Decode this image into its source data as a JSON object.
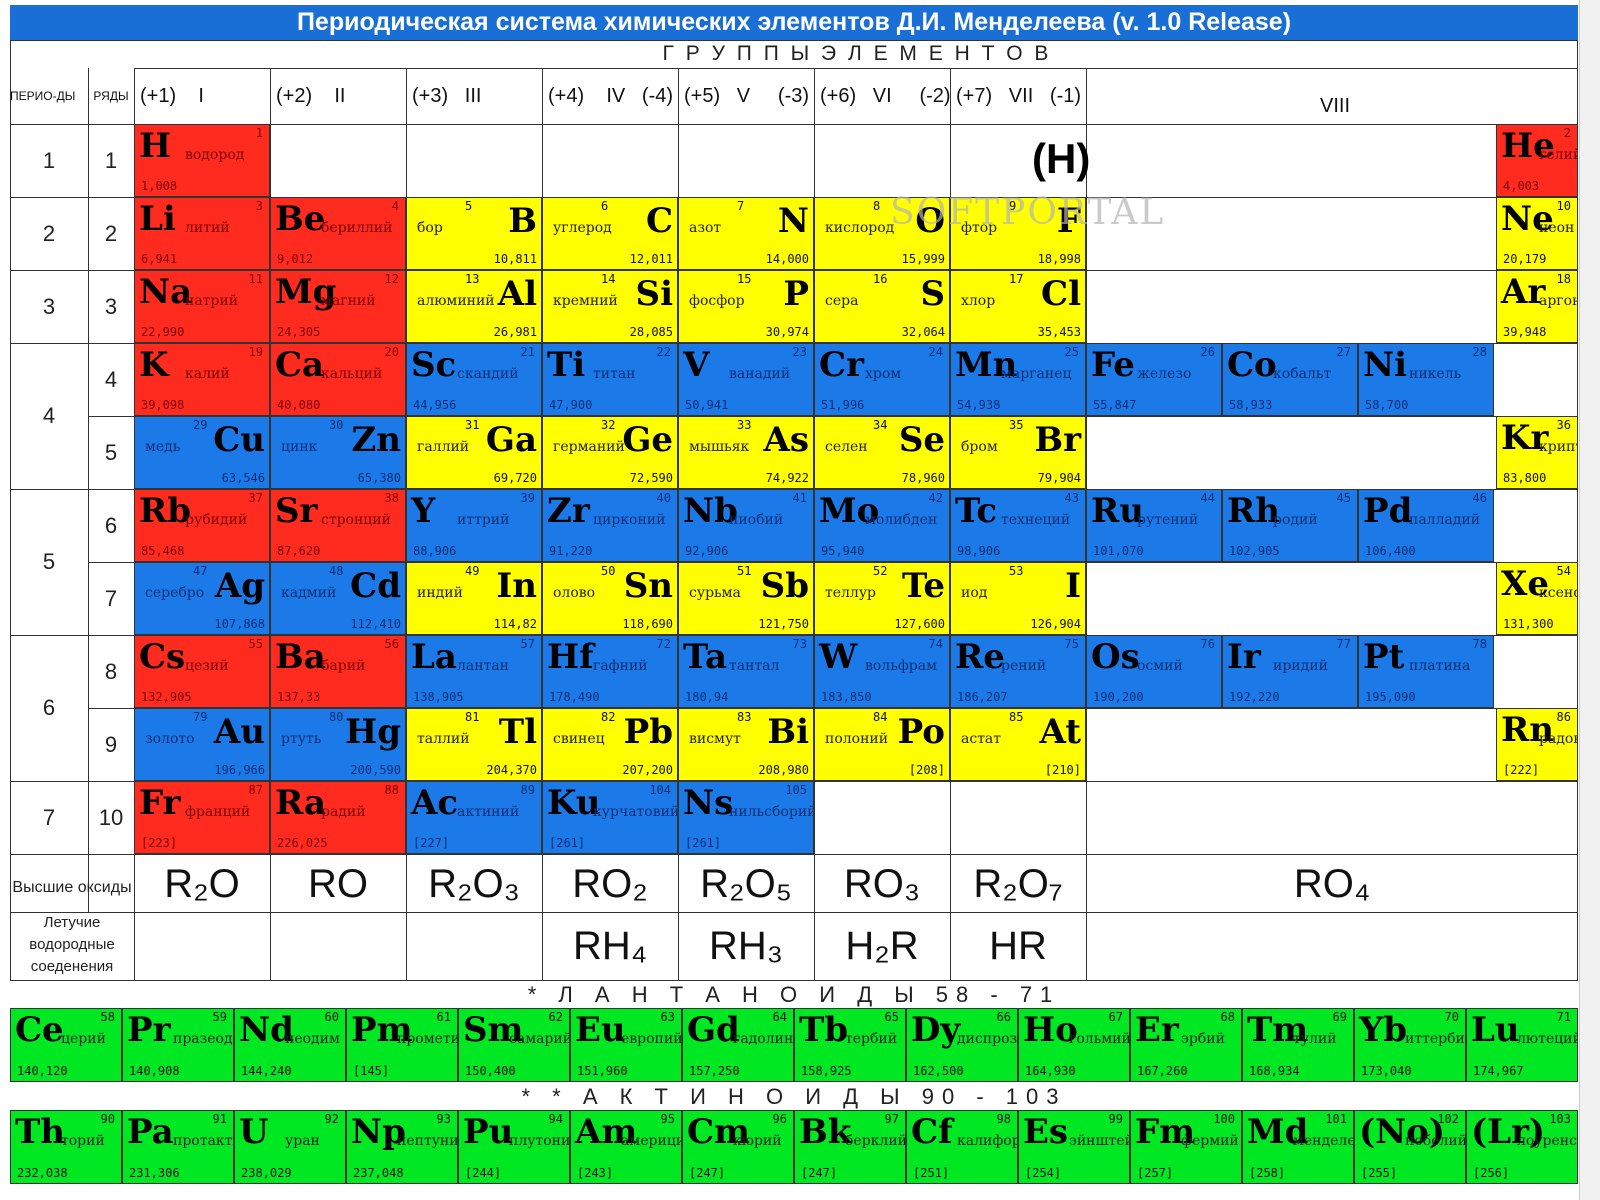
{
  "title": "Периодическая система химических элементов Д.И. Менделеева (v. 1.0 Release)",
  "groups_title": "Г Р У П П Ы      Э Л Е М Е Н Т О В",
  "headers": {
    "periods": "ПЕРИО-ДЫ",
    "rows": "РЯДЫ"
  },
  "group_labels": [
    "(+1)    I",
    "(+2)    II",
    "(+3)   III",
    "(+4)    IV   (-4)",
    "(+5)   V     (-3)",
    "(+6)   VI     (-2)",
    "(+7)   VII   (-1)",
    "VIII"
  ],
  "periods": [
    "1",
    "2",
    "3",
    "4",
    "5",
    "6",
    "7"
  ],
  "rows": [
    "1",
    "2",
    "3",
    "4",
    "5",
    "6",
    "7",
    "8",
    "9",
    "10"
  ],
  "h_mark": "(H)",
  "watermark": "SOFTPORTAL",
  "oxides_label": "Высшие оксиды",
  "oxides": [
    "R₂O",
    "RO",
    "R₂O₃",
    "RO₂",
    "R₂O₅",
    "RO₃",
    "R₂O₇",
    "RO₄"
  ],
  "hydrides_label": "Летучие водородные соеденения",
  "hydrides": [
    "RH₄",
    "RH₃",
    "H₂R",
    "HR"
  ],
  "lanthanides_label": "* Л А Н Т А Н О И Д Ы  58 - 71",
  "actinides_label": "* * А К Т И Н О И Д Ы  90 - 103",
  "elements": [
    {
      "s": "H",
      "n": "водород",
      "z": "1",
      "m": "1,008",
      "c": "red"
    },
    {
      "s": "He",
      "n": "гелий",
      "z": "2",
      "m": "4,003",
      "c": "red"
    },
    {
      "s": "Li",
      "n": "литий",
      "z": "3",
      "m": "6,941",
      "c": "red"
    },
    {
      "s": "Be",
      "n": "бериллий",
      "z": "4",
      "m": "9,012",
      "c": "red"
    },
    {
      "s": "B",
      "n": "бор",
      "z": "5",
      "m": "10,811",
      "c": "yel"
    },
    {
      "s": "C",
      "n": "углерод",
      "z": "6",
      "m": "12,011",
      "c": "yel"
    },
    {
      "s": "N",
      "n": "азот",
      "z": "7",
      "m": "14,000",
      "c": "yel"
    },
    {
      "s": "O",
      "n": "кислород",
      "z": "8",
      "m": "15,999",
      "c": "yel"
    },
    {
      "s": "F",
      "n": "фтор",
      "z": "9",
      "m": "18,998",
      "c": "yel"
    },
    {
      "s": "Ne",
      "n": "неон",
      "z": "10",
      "m": "20,179",
      "c": "yel"
    },
    {
      "s": "Na",
      "n": "натрий",
      "z": "11",
      "m": "22,990",
      "c": "red"
    },
    {
      "s": "Mg",
      "n": "магний",
      "z": "12",
      "m": "24,305",
      "c": "red"
    },
    {
      "s": "Al",
      "n": "алюминий",
      "z": "13",
      "m": "26,981",
      "c": "yel"
    },
    {
      "s": "Si",
      "n": "кремний",
      "z": "14",
      "m": "28,085",
      "c": "yel"
    },
    {
      "s": "P",
      "n": "фосфор",
      "z": "15",
      "m": "30,974",
      "c": "yel"
    },
    {
      "s": "S",
      "n": "сера",
      "z": "16",
      "m": "32,064",
      "c": "yel"
    },
    {
      "s": "Cl",
      "n": "хлор",
      "z": "17",
      "m": "35,453",
      "c": "yel"
    },
    {
      "s": "Ar",
      "n": "аргон",
      "z": "18",
      "m": "39,948",
      "c": "yel"
    },
    {
      "s": "K",
      "n": "калий",
      "z": "19",
      "m": "39,098",
      "c": "red"
    },
    {
      "s": "Ca",
      "n": "кальций",
      "z": "20",
      "m": "40,080",
      "c": "red"
    },
    {
      "s": "Sc",
      "n": "скандий",
      "z": "21",
      "m": "44,956",
      "c": "blu"
    },
    {
      "s": "Ti",
      "n": "титан",
      "z": "22",
      "m": "47,900",
      "c": "blu"
    },
    {
      "s": "V",
      "n": "ванадий",
      "z": "23",
      "m": "50,941",
      "c": "blu"
    },
    {
      "s": "Cr",
      "n": "хром",
      "z": "24",
      "m": "51,996",
      "c": "blu"
    },
    {
      "s": "Mn",
      "n": "марганец",
      "z": "25",
      "m": "54,938",
      "c": "blu"
    },
    {
      "s": "Fe",
      "n": "железо",
      "z": "26",
      "m": "55,847",
      "c": "blu"
    },
    {
      "s": "Co",
      "n": "кобальт",
      "z": "27",
      "m": "58,933",
      "c": "blu"
    },
    {
      "s": "Ni",
      "n": "никель",
      "z": "28",
      "m": "58,700",
      "c": "blu"
    },
    {
      "s": "Cu",
      "n": "медь",
      "z": "29",
      "m": "63,546",
      "c": "blu"
    },
    {
      "s": "Zn",
      "n": "цинк",
      "z": "30",
      "m": "65,380",
      "c": "blu"
    },
    {
      "s": "Ga",
      "n": "галлий",
      "z": "31",
      "m": "69,720",
      "c": "yel"
    },
    {
      "s": "Ge",
      "n": "германий",
      "z": "32",
      "m": "72,590",
      "c": "yel"
    },
    {
      "s": "As",
      "n": "мышьяк",
      "z": "33",
      "m": "74,922",
      "c": "yel"
    },
    {
      "s": "Se",
      "n": "селен",
      "z": "34",
      "m": "78,960",
      "c": "yel"
    },
    {
      "s": "Br",
      "n": "бром",
      "z": "35",
      "m": "79,904",
      "c": "yel"
    },
    {
      "s": "Kr",
      "n": "криптон",
      "z": "36",
      "m": "83,800",
      "c": "yel"
    },
    {
      "s": "Rb",
      "n": "рубидий",
      "z": "37",
      "m": "85,468",
      "c": "red"
    },
    {
      "s": "Sr",
      "n": "стронций",
      "z": "38",
      "m": "87,620",
      "c": "red"
    },
    {
      "s": "Y",
      "n": "иттрий",
      "z": "39",
      "m": "88,906",
      "c": "blu"
    },
    {
      "s": "Zr",
      "n": "цирконий",
      "z": "40",
      "m": "91,220",
      "c": "blu"
    },
    {
      "s": "Nb",
      "n": "ниобий",
      "z": "41",
      "m": "92,906",
      "c": "blu"
    },
    {
      "s": "Mo",
      "n": "молибден",
      "z": "42",
      "m": "95,940",
      "c": "blu"
    },
    {
      "s": "Tc",
      "n": "технеций",
      "z": "43",
      "m": "98,906",
      "c": "blu"
    },
    {
      "s": "Ru",
      "n": "рутений",
      "z": "44",
      "m": "101,070",
      "c": "blu"
    },
    {
      "s": "Rh",
      "n": "родий",
      "z": "45",
      "m": "102,905",
      "c": "blu"
    },
    {
      "s": "Pd",
      "n": "палладий",
      "z": "46",
      "m": "106,400",
      "c": "blu"
    },
    {
      "s": "Ag",
      "n": "серебро",
      "z": "47",
      "m": "107,868",
      "c": "blu"
    },
    {
      "s": "Cd",
      "n": "кадмий",
      "z": "48",
      "m": "112,410",
      "c": "blu"
    },
    {
      "s": "In",
      "n": "индий",
      "z": "49",
      "m": "114,82",
      "c": "yel"
    },
    {
      "s": "Sn",
      "n": "олово",
      "z": "50",
      "m": "118,690",
      "c": "yel"
    },
    {
      "s": "Sb",
      "n": "сурьма",
      "z": "51",
      "m": "121,750",
      "c": "yel"
    },
    {
      "s": "Te",
      "n": "теллур",
      "z": "52",
      "m": "127,600",
      "c": "yel"
    },
    {
      "s": "I",
      "n": "иод",
      "z": "53",
      "m": "126,904",
      "c": "yel"
    },
    {
      "s": "Xe",
      "n": "ксенон",
      "z": "54",
      "m": "131,300",
      "c": "yel"
    },
    {
      "s": "Cs",
      "n": "цезий",
      "z": "55",
      "m": "132,905",
      "c": "red"
    },
    {
      "s": "Ba",
      "n": "барий",
      "z": "56",
      "m": "137,33",
      "c": "red"
    },
    {
      "s": "La",
      "n": "лантан",
      "z": "57",
      "m": "138,905",
      "c": "blu"
    },
    {
      "s": "Hf",
      "n": "гафний",
      "z": "72",
      "m": "178,490",
      "c": "blu"
    },
    {
      "s": "Ta",
      "n": "тантал",
      "z": "73",
      "m": "180,94",
      "c": "blu"
    },
    {
      "s": "W",
      "n": "вольфрам",
      "z": "74",
      "m": "183,850",
      "c": "blu"
    },
    {
      "s": "Re",
      "n": "рений",
      "z": "75",
      "m": "186,207",
      "c": "blu"
    },
    {
      "s": "Os",
      "n": "осмий",
      "z": "76",
      "m": "190,200",
      "c": "blu"
    },
    {
      "s": "Ir",
      "n": "иридий",
      "z": "77",
      "m": "192,220",
      "c": "blu"
    },
    {
      "s": "Pt",
      "n": "платина",
      "z": "78",
      "m": "195,090",
      "c": "blu"
    },
    {
      "s": "Au",
      "n": "золото",
      "z": "79",
      "m": "196,966",
      "c": "blu"
    },
    {
      "s": "Hg",
      "n": "ртуть",
      "z": "80",
      "m": "200,590",
      "c": "blu"
    },
    {
      "s": "Tl",
      "n": "таллий",
      "z": "81",
      "m": "204,370",
      "c": "yel"
    },
    {
      "s": "Pb",
      "n": "свинец",
      "z": "82",
      "m": "207,200",
      "c": "yel"
    },
    {
      "s": "Bi",
      "n": "висмут",
      "z": "83",
      "m": "208,980",
      "c": "yel"
    },
    {
      "s": "Po",
      "n": "полоний",
      "z": "84",
      "m": "[208]",
      "c": "yel"
    },
    {
      "s": "At",
      "n": "астат",
      "z": "85",
      "m": "[210]",
      "c": "yel"
    },
    {
      "s": "Rn",
      "n": "радон",
      "z": "86",
      "m": "[222]",
      "c": "yel"
    },
    {
      "s": "Fr",
      "n": "франций",
      "z": "87",
      "m": "[223]",
      "c": "red"
    },
    {
      "s": "Ra",
      "n": "радий",
      "z": "88",
      "m": "226,025",
      "c": "red"
    },
    {
      "s": "Ac",
      "n": "актиний",
      "z": "89",
      "m": "[227]",
      "c": "blu"
    },
    {
      "s": "Ku",
      "n": "курчатовий",
      "z": "104",
      "m": "[261]",
      "c": "blu"
    },
    {
      "s": "Ns",
      "n": "нильсборий",
      "z": "105",
      "m": "[261]",
      "c": "blu"
    }
  ],
  "lanthanides": [
    {
      "s": "Ce",
      "n": "церий",
      "z": "58",
      "m": "140,120"
    },
    {
      "s": "Pr",
      "n": "празеодим",
      "z": "59",
      "m": "140,908"
    },
    {
      "s": "Nd",
      "n": "неодим",
      "z": "60",
      "m": "144,240"
    },
    {
      "s": "Pm",
      "n": "прометий",
      "z": "61",
      "m": "[145]"
    },
    {
      "s": "Sm",
      "n": "самарий",
      "z": "62",
      "m": "150,400"
    },
    {
      "s": "Eu",
      "n": "европий",
      "z": "63",
      "m": "151,960"
    },
    {
      "s": "Gd",
      "n": "гадолиний",
      "z": "64",
      "m": "157,250"
    },
    {
      "s": "Tb",
      "n": "тербий",
      "z": "65",
      "m": "158,925"
    },
    {
      "s": "Dy",
      "n": "диспрозий",
      "z": "66",
      "m": "162,500"
    },
    {
      "s": "Ho",
      "n": "гольмий",
      "z": "67",
      "m": "164,930"
    },
    {
      "s": "Er",
      "n": "эрбий",
      "z": "68",
      "m": "167,260"
    },
    {
      "s": "Tm",
      "n": "тулий",
      "z": "69",
      "m": "168,934"
    },
    {
      "s": "Yb",
      "n": "иттербий",
      "z": "70",
      "m": "173,040"
    },
    {
      "s": "Lu",
      "n": "лютеций",
      "z": "71",
      "m": "174,967"
    }
  ],
  "actinides": [
    {
      "s": "Th",
      "n": "торий",
      "z": "90",
      "m": "232,038"
    },
    {
      "s": "Pa",
      "n": "протактиний",
      "z": "91",
      "m": "231,306"
    },
    {
      "s": "U",
      "n": "уран",
      "z": "92",
      "m": "238,029"
    },
    {
      "s": "Np",
      "n": "нептуний",
      "z": "93",
      "m": "237,048"
    },
    {
      "s": "Pu",
      "n": "плутоний",
      "z": "94",
      "m": "[244]"
    },
    {
      "s": "Am",
      "n": "америций",
      "z": "95",
      "m": "[243]"
    },
    {
      "s": "Cm",
      "n": "кюрий",
      "z": "96",
      "m": "[247]"
    },
    {
      "s": "Bk",
      "n": "берклий",
      "z": "97",
      "m": "[247]"
    },
    {
      "s": "Cf",
      "n": "калифорний",
      "z": "98",
      "m": "[251]"
    },
    {
      "s": "Es",
      "n": "эйнштейний",
      "z": "99",
      "m": "[254]"
    },
    {
      "s": "Fm",
      "n": "фермий",
      "z": "100",
      "m": "[257]"
    },
    {
      "s": "Md",
      "n": "менделевий",
      "z": "101",
      "m": "[258]"
    },
    {
      "s": "(No)",
      "n": "нобелий",
      "z": "102",
      "m": "[255]"
    },
    {
      "s": "(Lr)",
      "n": "лоуренсий",
      "z": "103",
      "m": "[256]"
    }
  ]
}
